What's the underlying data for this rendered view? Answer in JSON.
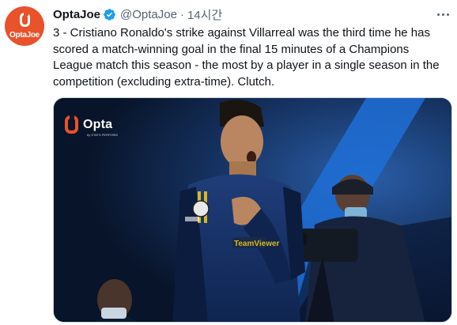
{
  "tweet": {
    "author_name": "OptaJoe",
    "author_handle": "@OptaJoe",
    "separator": "·",
    "timestamp": "14시간",
    "text": "3 - Cristiano Ronaldo's strike against Villarreal was the third time he has scored a match-winning goal in the final 15 minutes of a Champions League match this season - the most by a player in a single season in the competition (excluding extra-time). Clutch.",
    "avatar_label": "OptaJoe",
    "more_icon": "more-horizontal-icon",
    "verified_icon": "verified-badge-icon"
  },
  "media": {
    "watermark_brand": "Opta",
    "watermark_sub": "by STATS PERFORM"
  },
  "colors": {
    "brand_orange": "#e9522a",
    "verified_blue": "#1d9bf0",
    "text_primary": "#0f1419",
    "text_secondary": "#536471"
  }
}
